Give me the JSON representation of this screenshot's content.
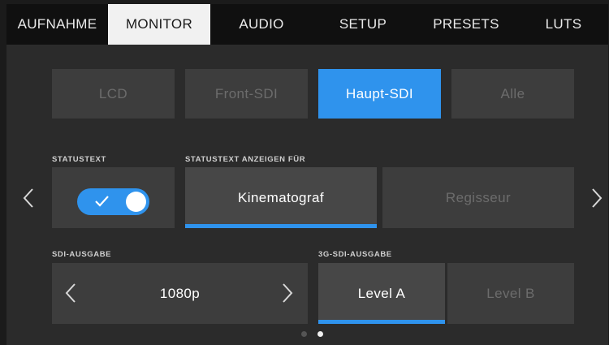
{
  "tabs": [
    {
      "label": "AUFNAHME",
      "active": false
    },
    {
      "label": "MONITOR",
      "active": true
    },
    {
      "label": "AUDIO",
      "active": false
    },
    {
      "label": "SETUP",
      "active": false
    },
    {
      "label": "PRESETS",
      "active": false
    },
    {
      "label": "LUTS",
      "active": false
    }
  ],
  "outputs": {
    "items": [
      "LCD",
      "Front-SDI",
      "Haupt-SDI",
      "Alle"
    ],
    "selected": "Haupt-SDI"
  },
  "status_text": {
    "label": "STATUSTEXT",
    "enabled": true
  },
  "show_for": {
    "label": "STATUSTEXT ANZEIGEN FÜR",
    "options": [
      "Kinematograf",
      "Regisseur"
    ],
    "selected": "Kinematograf"
  },
  "sdi_output": {
    "label": "SDI-AUSGABE",
    "value": "1080p"
  },
  "sdi_3g": {
    "label": "3G-SDI-AUSGABE",
    "options": [
      "Level A",
      "Level B"
    ],
    "selected": "Level A"
  },
  "pagination": {
    "pages": 2,
    "current": 2
  },
  "colors": {
    "accent": "#2f93ed",
    "active_tab_bg": "#f1f1f1",
    "panel_bg": "#2b2b2b",
    "button_bg": "#3d3d3d",
    "dim_text": "#6c6c6c"
  },
  "icons": {
    "prev_page": "chevron-left-icon",
    "next_page": "chevron-right-icon",
    "toggle_check": "check-icon",
    "sdi_prev": "chevron-left-icon",
    "sdi_next": "chevron-right-icon"
  }
}
